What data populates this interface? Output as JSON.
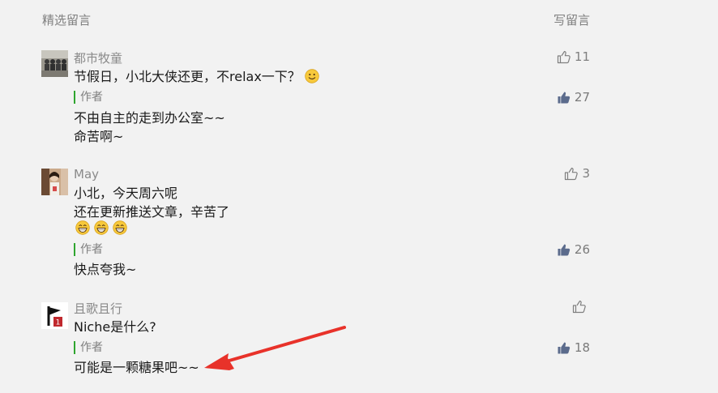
{
  "header": {
    "title": "精选留言",
    "write": "写留言"
  },
  "comments": [
    {
      "nickname": "都市牧童",
      "content": "节假日，小北大侠还更，不relax一下？",
      "likes": "11",
      "reply": {
        "author_label": "作者",
        "content": "不由自主的走到办公室~~\n命苦啊~",
        "likes": "27"
      }
    },
    {
      "nickname": "May",
      "content": "小北，今天周六呢\n还在更新推送文章，辛苦了",
      "likes": "3",
      "reply": {
        "author_label": "作者",
        "content": "快点夸我~",
        "likes": "26"
      }
    },
    {
      "nickname": "且歌且行",
      "content": "Niche是什么?",
      "likes": "",
      "reply": {
        "author_label": "作者",
        "content": "可能是一颗糖果吧~~",
        "likes": "18"
      }
    }
  ],
  "icons": {
    "like_outline": "thumbs-up-outline-icon",
    "like_filled": "thumbs-up-filled-icon",
    "smile": "smile-emoji-icon",
    "grin": "grin-emoji-icon",
    "arrow": "red-arrow-annotation"
  },
  "colors": {
    "accent_green": "#2fa52f",
    "like_filled": "#5b6b8c",
    "arrow": "#e8322a"
  }
}
